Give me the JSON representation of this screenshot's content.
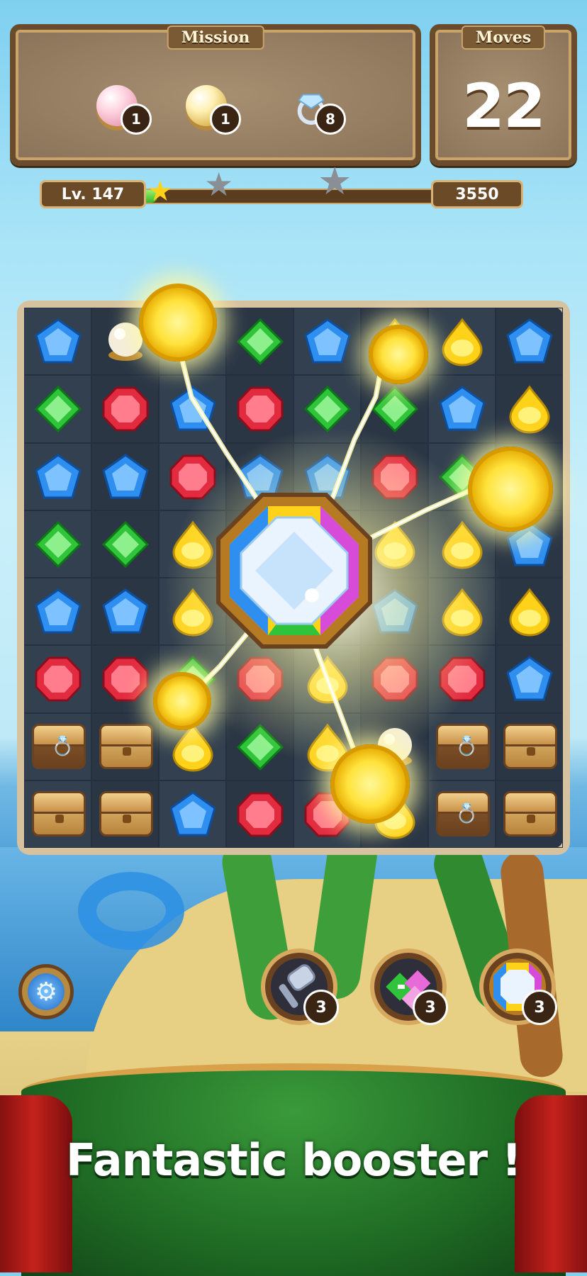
{
  "hud": {
    "mission_title": "Mission",
    "moves_title": "Moves",
    "moves_value": "22",
    "missions": [
      {
        "icon": "pink-pearl-icon",
        "count": "1"
      },
      {
        "icon": "gold-pearl-icon",
        "count": "1"
      },
      {
        "icon": "diamond-ring-icon",
        "count": "8"
      }
    ]
  },
  "level": {
    "label": "Lv. 147",
    "score": "3550",
    "progress": 0.1
  },
  "boosters": [
    {
      "name": "hammer-booster",
      "count": "3"
    },
    {
      "name": "cross-gem-booster",
      "count": "3"
    },
    {
      "name": "rainbow-diamond-booster",
      "count": "3"
    }
  ],
  "banner": {
    "text": "Fantastic booster !"
  },
  "board": {
    "rows": [
      [
        "blue",
        "pearl",
        "coin",
        "green",
        "blue",
        "yellow",
        "yellow",
        "blue"
      ],
      [
        "green",
        "red",
        "blue",
        "red",
        "green",
        "green",
        "blue",
        "yellow"
      ],
      [
        "blue",
        "blue",
        "red",
        "blue",
        "blue",
        "red",
        "green",
        "yellow"
      ],
      [
        "green",
        "green",
        "yellow",
        "red",
        "red",
        "yellow",
        "yellow",
        "blue"
      ],
      [
        "blue",
        "blue",
        "yellow",
        "red",
        "yellow",
        "blue",
        "yellow",
        "yellow"
      ],
      [
        "red",
        "red",
        "green",
        "red",
        "yellow",
        "red",
        "red",
        "blue"
      ],
      [
        "chest-ring",
        "chest",
        "yellow",
        "green",
        "yellow",
        "pearl",
        "chest-ring",
        "chest"
      ],
      [
        "chest",
        "chest",
        "blue",
        "red",
        "red",
        "yellow",
        "chest-ring",
        "chest"
      ]
    ]
  },
  "colors": {
    "blue": "#2f8ff0",
    "green": "#2fc43a",
    "red": "#e32b3f",
    "yellow": "#ffd21a",
    "pearl": "#f4eddc"
  }
}
